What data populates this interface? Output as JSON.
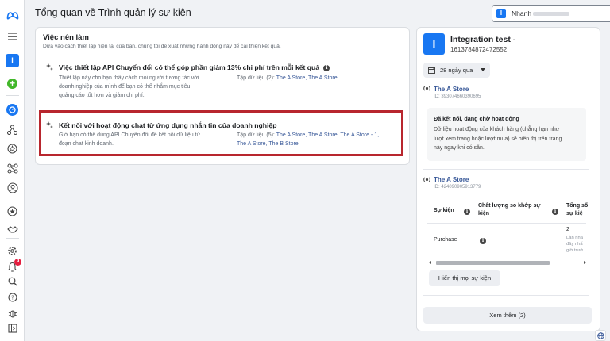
{
  "header": {
    "title": "Tổng quan về Trình quản lý sự kiện",
    "account": {
      "avatar_letter": "I",
      "name": "Nhanh"
    }
  },
  "nav": {
    "app_avatar_letter": "I",
    "notification_count": "9"
  },
  "recommendations": {
    "title": "Việc nên làm",
    "subtitle": "Dựa vào cách thiết lập hiện tại của bạn, chúng tôi đề xuất những hành động này để cải thiện kết quả.",
    "items": [
      {
        "title": "Việc thiết lập API Chuyển đổi có thể góp phần giảm 13% chi phí trên mỗi kết quả",
        "desc": [
          "Thiết lập này cho bạn thấy cách mọi người tương tác với",
          "doanh nghiệp của mình để bạn có thể nhắm mục tiêu",
          "quảng cáo tốt hơn và giảm chi phí."
        ],
        "data_prefix": "Tập dữ liệu (2):",
        "data_line1": "The A Store, The A Store",
        "data_line2": ""
      },
      {
        "title": "Kết nối với hoạt động chat từ ứng dụng nhắn tin của doanh nghiệp",
        "desc": [
          "Giờ bạn có thể dùng API Chuyển đổi để kết nối dữ liệu từ",
          "đoạn chat kinh doanh."
        ],
        "data_prefix": "Tập dữ liệu (5):",
        "data_line1": "The A Store, The A Store, The A Store - 1,",
        "data_line2": "The A Store, The B Store"
      }
    ]
  },
  "dataset": {
    "avatar_letter": "I",
    "name": "Integration test -",
    "id": "1613784872472552",
    "range": "28 ngày qua",
    "sources": [
      {
        "name": "The A Store",
        "id": "ID: 393074660390695",
        "status_title": "Đã kết nối, đang chờ hoạt động",
        "status_text": [
          "Dữ liệu hoạt động của khách hàng (chẳng hạn như",
          "lượt xem trang hoặc lượt mua) sẽ hiển thị trên trang",
          "này ngay khi có sẵn."
        ]
      },
      {
        "name": "The A Store",
        "id": "ID: 424090905913779"
      }
    ],
    "table": {
      "headers": [
        "Sự kiện",
        "Chất lượng so khớp sự kiện",
        "Tổng số sự kiện"
      ],
      "header_lines": {
        "match1": "Chất lượng so khớp sự",
        "match2": "kiện",
        "total1": "Tổng số",
        "total2": "sự kiệ"
      },
      "row": {
        "event": "Purchase",
        "total": "2",
        "total_note": [
          "Lần nhậ",
          "đây nhấ",
          "giờ trướ"
        ]
      }
    },
    "show_all_events": "Hiển thị mọi sự kiện",
    "see_more": "Xem thêm (2)"
  },
  "colors": {
    "accent": "#1877f2",
    "link": "#385898",
    "highlight": "#b8262e",
    "add": "#42b72a"
  }
}
